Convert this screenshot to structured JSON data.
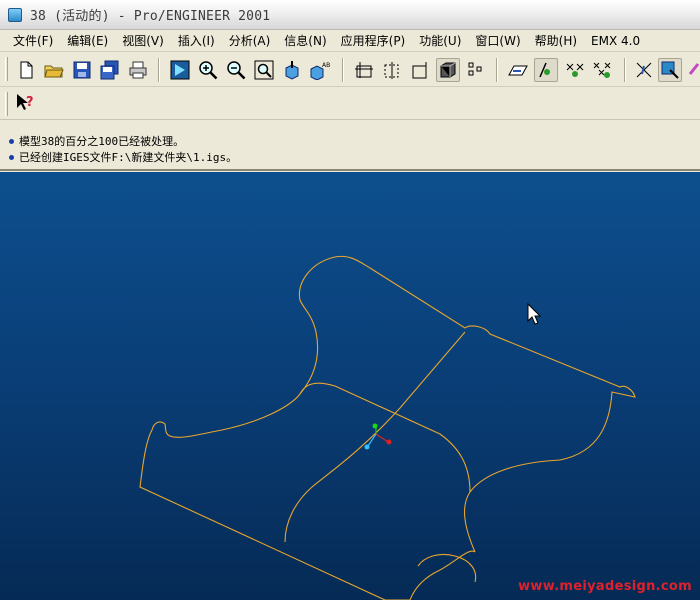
{
  "window": {
    "title": "38 (活动的) - Pro/ENGINEER 2001"
  },
  "menu": {
    "items": [
      "文件(F)",
      "编辑(E)",
      "视图(V)",
      "插入(I)",
      "分析(A)",
      "信息(N)",
      "应用程序(P)",
      "功能(U)",
      "窗口(W)",
      "帮助(H)",
      "EMX 4.0"
    ]
  },
  "messages": [
    "模型38的百分之100已经被处理。",
    "已经创建IGES文件F:\\新建文件夹\\1.igs。"
  ],
  "viewport": {
    "watermark": "www.meiyadesign.com",
    "curve_color": "#E8A62E",
    "bg_top": "#0d4f8e",
    "bg_bottom": "#052a55"
  }
}
